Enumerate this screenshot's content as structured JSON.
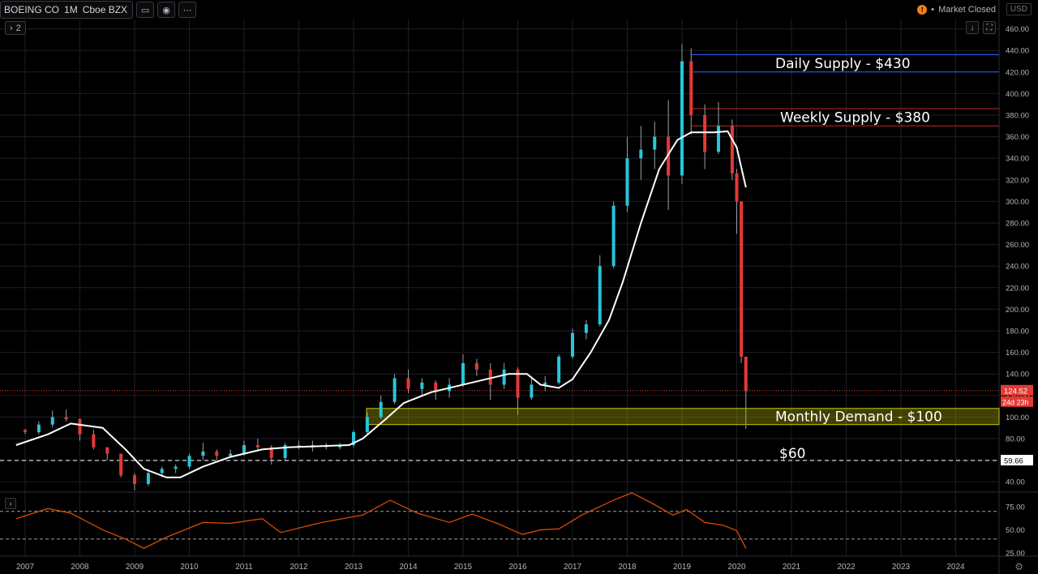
{
  "symbol": {
    "name": "BOEING CO",
    "interval": "1M",
    "exchange": "Cboe BZX"
  },
  "legend_count": "2",
  "market_status": "Market Closed",
  "market_icon": "!",
  "currency": "USD",
  "countdown": "24d 23h",
  "colors": {
    "up": "#26c6da",
    "up_alt": "#00e676",
    "down": "#e53935",
    "ma": "#ffffff",
    "rsi": "#e65100",
    "daily_zone": "#2962ff",
    "weekly_zone": "#c62828",
    "demand_zone": "#c8c800"
  },
  "chart_data": [
    {
      "type": "candlestick",
      "symbol": "BOEING CO",
      "interval": "1M",
      "ylim": [
        30,
        470
      ],
      "y_ticks": [
        40,
        60,
        80,
        100,
        120,
        140,
        160,
        180,
        200,
        220,
        240,
        260,
        280,
        300,
        320,
        340,
        360,
        380,
        400,
        420,
        440,
        460
      ],
      "x_ticks": [
        "2007",
        "2008",
        "2009",
        "2010",
        "2011",
        "2012",
        "2013",
        "2014",
        "2015",
        "2016",
        "2017",
        "2018",
        "2019",
        "2020",
        "2021",
        "2022",
        "2023",
        "2024"
      ],
      "grid": true,
      "price_labels": [
        {
          "value": 124.52,
          "text": "124.52"
        },
        {
          "value": 59.66,
          "text": "59.66"
        }
      ],
      "annotations": [
        {
          "text": "Daily Supply - $430",
          "kind": "zone",
          "y_top": 436,
          "y_bottom": 420,
          "color": "#2962ff"
        },
        {
          "text": "Weekly Supply - $380",
          "kind": "zone",
          "y_top": 386,
          "y_bottom": 370,
          "color": "#c62828"
        },
        {
          "text": "Monthly Demand - $100",
          "kind": "zone",
          "y_top": 108,
          "y_bottom": 93,
          "color": "#c8c800"
        },
        {
          "text": "$60",
          "kind": "level",
          "y": 59.66
        }
      ],
      "ma_points": [
        [
          "2006-11",
          74
        ],
        [
          "2007-06",
          84
        ],
        [
          "2007-11",
          94
        ],
        [
          "2008-06",
          90
        ],
        [
          "2008-11",
          70
        ],
        [
          "2009-03",
          52
        ],
        [
          "2009-08",
          44
        ],
        [
          "2009-11",
          44
        ],
        [
          "2010-04",
          54
        ],
        [
          "2010-10",
          63
        ],
        [
          "2011-05",
          70
        ],
        [
          "2011-11",
          72
        ],
        [
          "2012-06",
          73
        ],
        [
          "2012-12",
          74
        ],
        [
          "2013-03",
          80
        ],
        [
          "2013-08",
          98
        ],
        [
          "2013-12",
          113
        ],
        [
          "2014-06",
          123
        ],
        [
          "2014-12",
          129
        ],
        [
          "2015-06",
          135
        ],
        [
          "2015-11",
          140
        ],
        [
          "2016-03",
          140
        ],
        [
          "2016-06",
          130
        ],
        [
          "2016-10",
          127
        ],
        [
          "2017-01",
          135
        ],
        [
          "2017-05",
          160
        ],
        [
          "2017-09",
          190
        ],
        [
          "2017-12",
          225
        ],
        [
          "2018-04",
          280
        ],
        [
          "2018-08",
          330
        ],
        [
          "2018-12",
          357
        ],
        [
          "2019-03",
          364
        ],
        [
          "2019-08",
          364
        ],
        [
          "2019-11",
          365
        ],
        [
          "2020-01",
          350
        ],
        [
          "2020-03",
          313
        ]
      ],
      "candles": [
        [
          "2007-01",
          88,
          89,
          84,
          86
        ],
        [
          "2007-04",
          86,
          96,
          84,
          93
        ],
        [
          "2007-07",
          93,
          106,
          90,
          100
        ],
        [
          "2007-10",
          100,
          107,
          96,
          98
        ],
        [
          "2008-01",
          98,
          99,
          78,
          84
        ],
        [
          "2008-04",
          84,
          88,
          70,
          72
        ],
        [
          "2008-07",
          72,
          70,
          60,
          66
        ],
        [
          "2008-10",
          66,
          66,
          44,
          46
        ],
        [
          "2009-01",
          46,
          48,
          32,
          38
        ],
        [
          "2009-04",
          38,
          52,
          36,
          48
        ],
        [
          "2009-07",
          48,
          54,
          44,
          52
        ],
        [
          "2009-10",
          52,
          56,
          48,
          54
        ],
        [
          "2010-01",
          54,
          66,
          52,
          64
        ],
        [
          "2010-04",
          64,
          76,
          60,
          68
        ],
        [
          "2010-07",
          68,
          70,
          60,
          64
        ],
        [
          "2010-10",
          64,
          70,
          62,
          66
        ],
        [
          "2011-01",
          66,
          78,
          64,
          74
        ],
        [
          "2011-04",
          74,
          80,
          68,
          72
        ],
        [
          "2011-07",
          72,
          74,
          56,
          62
        ],
        [
          "2011-10",
          62,
          76,
          60,
          74
        ],
        [
          "2012-01",
          74,
          78,
          70,
          72
        ],
        [
          "2012-04",
          72,
          78,
          68,
          74
        ],
        [
          "2012-07",
          74,
          76,
          70,
          72
        ],
        [
          "2012-10",
          72,
          76,
          70,
          74
        ],
        [
          "2013-01",
          74,
          88,
          72,
          86
        ],
        [
          "2013-04",
          86,
          104,
          84,
          100
        ],
        [
          "2013-07",
          100,
          120,
          98,
          114
        ],
        [
          "2013-10",
          114,
          140,
          112,
          136
        ],
        [
          "2014-01",
          136,
          144,
          122,
          126
        ],
        [
          "2014-04",
          126,
          136,
          120,
          132
        ],
        [
          "2014-07",
          132,
          134,
          116,
          124
        ],
        [
          "2014-10",
          124,
          136,
          118,
          130
        ],
        [
          "2015-01",
          130,
          158,
          128,
          150
        ],
        [
          "2015-04",
          150,
          154,
          138,
          144
        ],
        [
          "2015-07",
          144,
          150,
          116,
          130
        ],
        [
          "2015-10",
          130,
          150,
          126,
          144
        ],
        [
          "2016-01",
          144,
          146,
          102,
          118
        ],
        [
          "2016-04",
          118,
          136,
          116,
          130
        ],
        [
          "2016-07",
          130,
          138,
          124,
          132
        ],
        [
          "2016-10",
          132,
          158,
          130,
          156
        ],
        [
          "2017-01",
          156,
          182,
          154,
          178
        ],
        [
          "2017-04",
          178,
          190,
          172,
          186
        ],
        [
          "2017-07",
          186,
          250,
          184,
          240
        ],
        [
          "2017-10",
          240,
          300,
          238,
          296
        ],
        [
          "2018-01",
          296,
          360,
          290,
          340
        ],
        [
          "2018-04",
          340,
          370,
          320,
          348
        ],
        [
          "2018-07",
          348,
          374,
          330,
          360
        ],
        [
          "2018-10",
          360,
          394,
          292,
          324
        ],
        [
          "2019-01",
          324,
          446,
          316,
          430
        ],
        [
          "2019-03",
          430,
          442,
          362,
          380
        ],
        [
          "2019-06",
          380,
          390,
          330,
          346
        ],
        [
          "2019-09",
          346,
          392,
          344,
          370
        ],
        [
          "2019-12",
          370,
          376,
          320,
          326
        ],
        [
          "2020-01",
          326,
          330,
          270,
          300
        ],
        [
          "2020-02",
          300,
          300,
          150,
          156
        ],
        [
          "2020-03",
          156,
          156,
          89,
          124
        ]
      ],
      "rsi": {
        "levels": [
          70,
          40
        ],
        "ticks": [
          25,
          50,
          75
        ],
        "points": [
          [
            "2006-11",
            62
          ],
          [
            "2007-06",
            73
          ],
          [
            "2007-11",
            68
          ],
          [
            "2008-06",
            50
          ],
          [
            "2008-11",
            40
          ],
          [
            "2009-03",
            30
          ],
          [
            "2009-08",
            42
          ],
          [
            "2010-04",
            58
          ],
          [
            "2010-10",
            57
          ],
          [
            "2011-05",
            62
          ],
          [
            "2011-09",
            47
          ],
          [
            "2012-06",
            58
          ],
          [
            "2013-03",
            66
          ],
          [
            "2013-09",
            82
          ],
          [
            "2014-03",
            68
          ],
          [
            "2014-10",
            58
          ],
          [
            "2015-03",
            67
          ],
          [
            "2015-09",
            56
          ],
          [
            "2016-02",
            45
          ],
          [
            "2016-06",
            50
          ],
          [
            "2016-10",
            51
          ],
          [
            "2017-03",
            66
          ],
          [
            "2017-10",
            82
          ],
          [
            "2018-02",
            90
          ],
          [
            "2018-06",
            80
          ],
          [
            "2018-11",
            66
          ],
          [
            "2019-02",
            72
          ],
          [
            "2019-06",
            58
          ],
          [
            "2019-10",
            55
          ],
          [
            "2020-01",
            49
          ],
          [
            "2020-03",
            30
          ]
        ]
      }
    }
  ]
}
